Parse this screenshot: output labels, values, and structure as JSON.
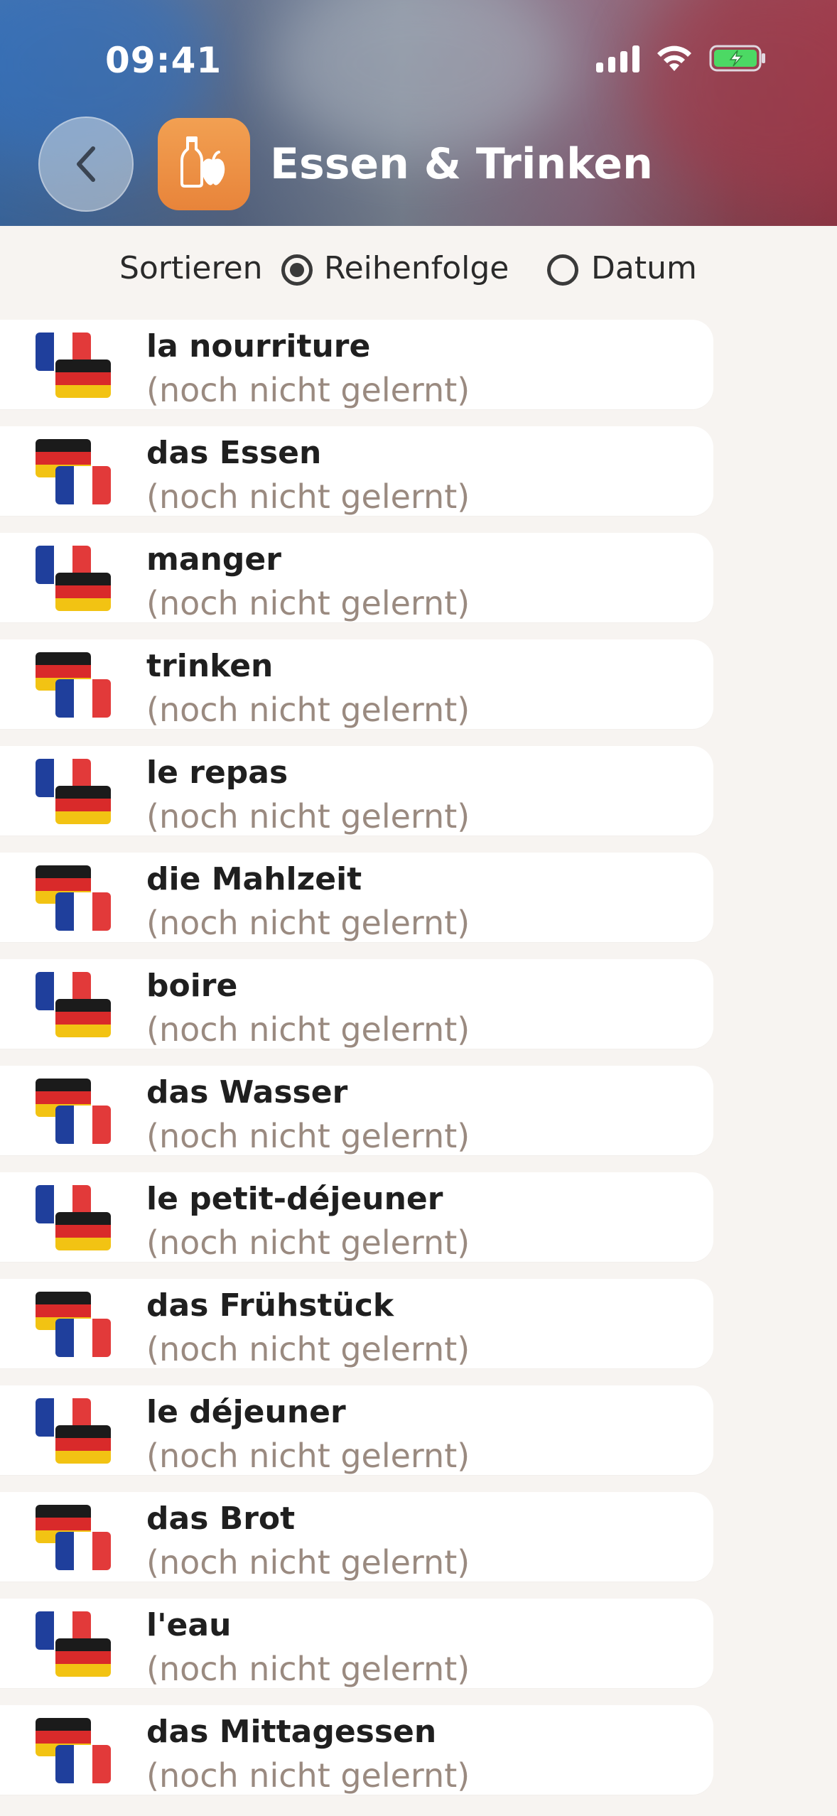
{
  "status": {
    "time": "09:41"
  },
  "header": {
    "title": "Essen & Trinken",
    "back_icon": "chevron-left-icon",
    "app_icon": "food-drink-icon"
  },
  "sort": {
    "label": "Sortieren",
    "options": [
      {
        "label": "Reihenfolge",
        "selected": true
      },
      {
        "label": "Datum",
        "selected": false
      }
    ]
  },
  "colors": {
    "flag_fr": [
      "#1f3f9c",
      "#ffffff",
      "#e23a3a"
    ],
    "flag_de": [
      "#1b1b1b",
      "#d92a2a",
      "#f2c313"
    ],
    "subtitle": "#9a8a80",
    "accent": "#e8843a"
  },
  "items": [
    {
      "title": "la nourriture",
      "status": "(noch nicht gelernt)",
      "direction": "fr-de"
    },
    {
      "title": "das Essen",
      "status": "(noch nicht gelernt)",
      "direction": "de-fr"
    },
    {
      "title": "manger",
      "status": "(noch nicht gelernt)",
      "direction": "fr-de"
    },
    {
      "title": "trinken",
      "status": "(noch nicht gelernt)",
      "direction": "de-fr"
    },
    {
      "title": "le repas",
      "status": "(noch nicht gelernt)",
      "direction": "fr-de"
    },
    {
      "title": "die Mahlzeit",
      "status": "(noch nicht gelernt)",
      "direction": "de-fr"
    },
    {
      "title": "boire",
      "status": "(noch nicht gelernt)",
      "direction": "fr-de"
    },
    {
      "title": "das Wasser",
      "status": "(noch nicht gelernt)",
      "direction": "de-fr"
    },
    {
      "title": "le petit-déjeuner",
      "status": "(noch nicht gelernt)",
      "direction": "fr-de"
    },
    {
      "title": "das Frühstück",
      "status": "(noch nicht gelernt)",
      "direction": "de-fr"
    },
    {
      "title": "le déjeuner",
      "status": "(noch nicht gelernt)",
      "direction": "fr-de"
    },
    {
      "title": "das Brot",
      "status": "(noch nicht gelernt)",
      "direction": "de-fr"
    },
    {
      "title": "l'eau",
      "status": "(noch nicht gelernt)",
      "direction": "fr-de"
    },
    {
      "title": "das Mittagessen",
      "status": "(noch nicht gelernt)",
      "direction": "de-fr"
    }
  ]
}
